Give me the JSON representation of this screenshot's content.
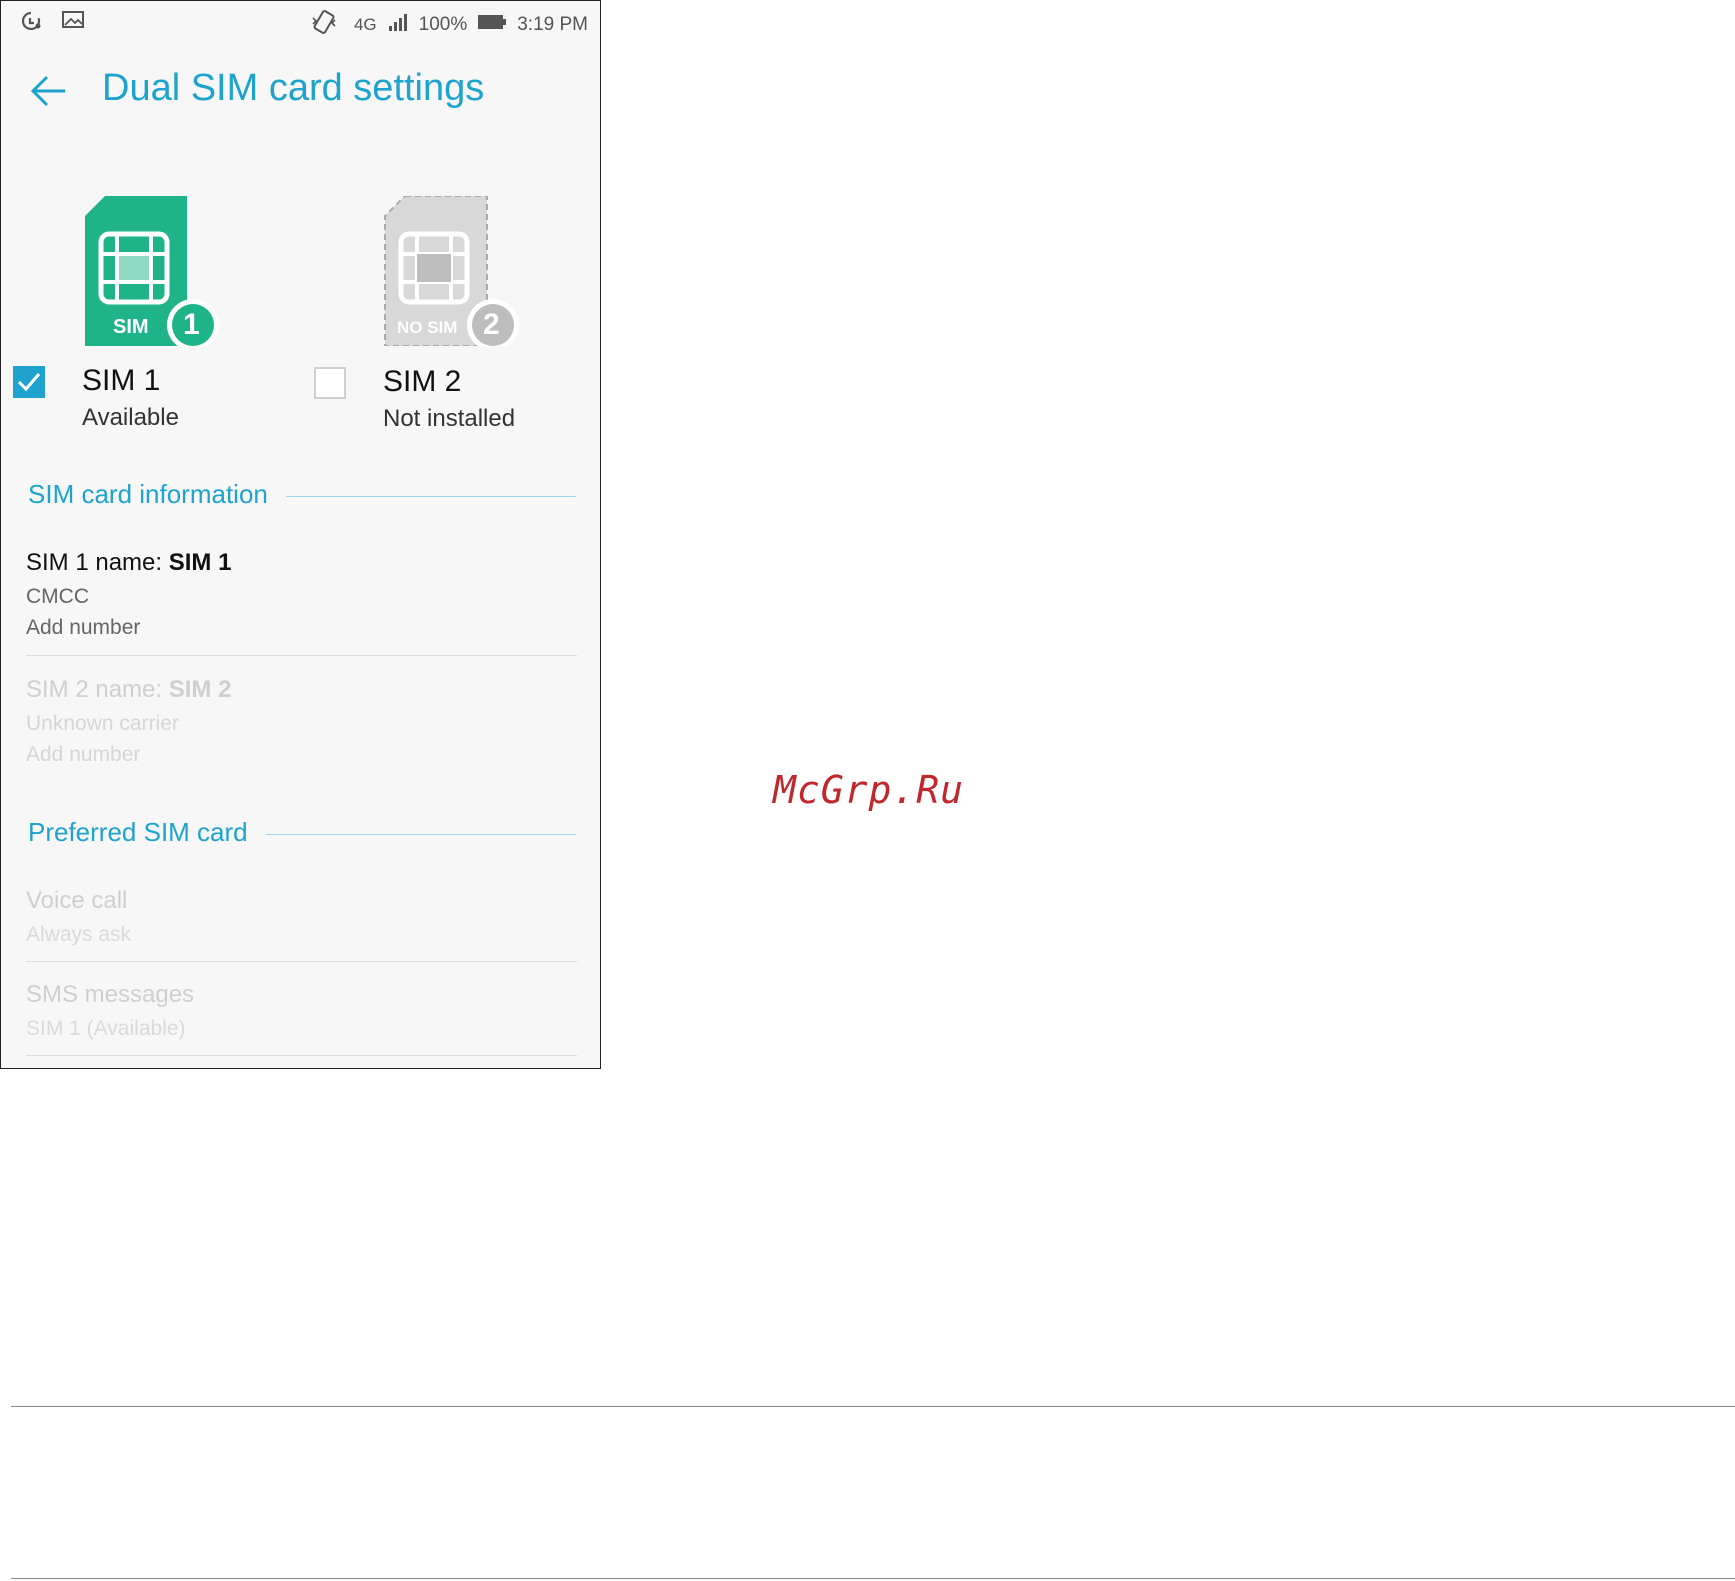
{
  "status_bar": {
    "network": "4G",
    "battery": "100%",
    "time": "3:19 PM",
    "left_icons": [
      "sync-icon",
      "image-icon"
    ],
    "right_icons": [
      "vibrate-icon",
      "network-4g-icon",
      "signal-icon",
      "battery-icon"
    ]
  },
  "header": {
    "title": "Dual SIM card settings",
    "back_icon": "arrow-left-icon"
  },
  "sims": [
    {
      "card_label": "SIM",
      "slot_number": "1",
      "name": "SIM 1",
      "status": "Available",
      "checked": true,
      "color": "#1fb38a"
    },
    {
      "card_label": "NO SIM",
      "slot_number": "2",
      "name": "SIM 2",
      "status": "Not installed",
      "checked": false,
      "color": "#cfcfcf"
    }
  ],
  "sim_info": {
    "section_title": "SIM card information",
    "sim1": {
      "name_label": "SIM 1 name: ",
      "name_value": "SIM 1",
      "carrier": "CMCC",
      "number": "Add number",
      "enabled": true
    },
    "sim2": {
      "name_label": "SIM 2 name: ",
      "name_value": "SIM 2",
      "carrier": "Unknown carrier",
      "number": "Add number",
      "enabled": false
    }
  },
  "preferred": {
    "section_title": "Preferred SIM card",
    "items": [
      {
        "title": "Voice call",
        "subtitle": "Always ask",
        "enabled": false
      },
      {
        "title": "SMS messages",
        "subtitle": "SIM 1 (Available)",
        "enabled": false
      }
    ]
  },
  "watermark": "McGrp.Ru",
  "colors": {
    "accent": "#1ea3cf",
    "sim_active": "#1fb38a",
    "sim_inactive": "#cfcfcf",
    "checkbox": "#1ea3cf",
    "watermark": "#c0282d"
  }
}
